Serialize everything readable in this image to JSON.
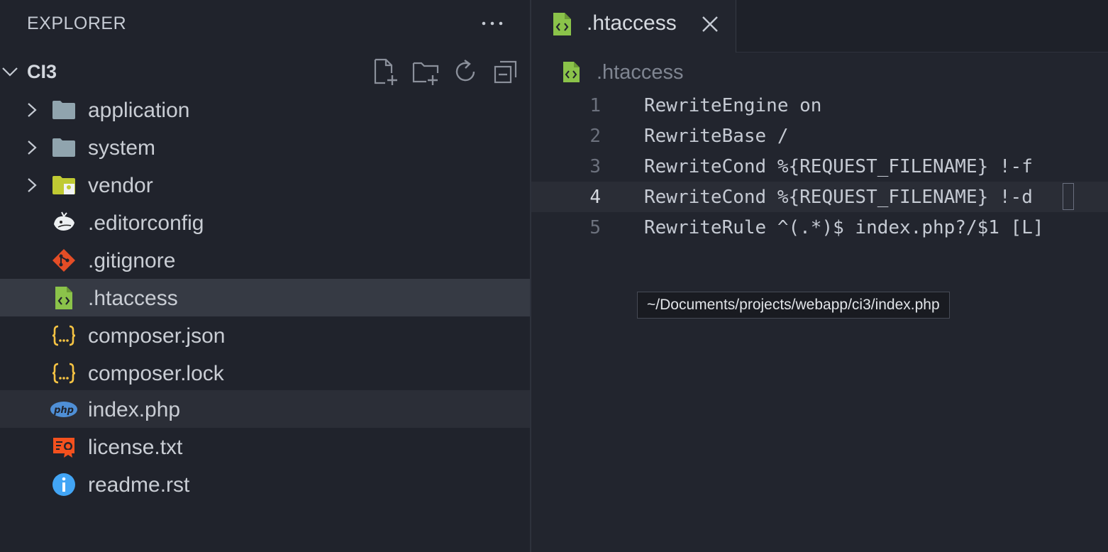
{
  "sidebar": {
    "title": "EXPLORER",
    "project": {
      "name": "CI3",
      "tools": [
        "new-file-icon",
        "new-folder-icon",
        "refresh-icon",
        "collapse-all-icon"
      ]
    },
    "items": [
      {
        "label": "application",
        "icon": "folder-icon",
        "type": "folder"
      },
      {
        "label": "system",
        "icon": "folder-icon",
        "type": "folder"
      },
      {
        "label": "vendor",
        "icon": "vendor-folder-icon",
        "type": "folder"
      },
      {
        "label": ".editorconfig",
        "icon": "editorconfig-icon",
        "type": "file"
      },
      {
        "label": ".gitignore",
        "icon": "git-icon",
        "type": "file"
      },
      {
        "label": ".htaccess",
        "icon": "htaccess-file-icon",
        "type": "file",
        "selected": true
      },
      {
        "label": "composer.json",
        "icon": "json-braces-icon",
        "type": "file"
      },
      {
        "label": "composer.lock",
        "icon": "json-braces-icon",
        "type": "file"
      },
      {
        "label": "index.php",
        "icon": "php-icon",
        "type": "file",
        "hover": true
      },
      {
        "label": "license.txt",
        "icon": "license-icon",
        "type": "file"
      },
      {
        "label": "readme.rst",
        "icon": "info-icon",
        "type": "file"
      }
    ]
  },
  "editor": {
    "tab": {
      "label": ".htaccess",
      "icon": "htaccess-file-icon"
    },
    "breadcrumb": ".htaccess",
    "lines": [
      {
        "n": "1",
        "text": "RewriteEngine on"
      },
      {
        "n": "2",
        "text": "RewriteBase /"
      },
      {
        "n": "3",
        "text": "RewriteCond %{REQUEST_FILENAME} !-f"
      },
      {
        "n": "4",
        "text": "RewriteCond %{REQUEST_FILENAME} !-d",
        "current": true
      },
      {
        "n": "5",
        "text": "RewriteRule ^(.*)$ index.php?/$1 [L]"
      }
    ],
    "tooltip": "~/Documents/projects/webapp/ci3/index.php"
  },
  "colors": {
    "sidebar_bg": "#20232c",
    "editor_bg": "#22252e",
    "selected_row": "#363a44",
    "htaccess_green": "#8bc34a",
    "folder_gray": "#90a4ae",
    "json_yellow": "#f6c343",
    "git_orange": "#e44d26",
    "php_blue": "#4f8fd6",
    "info_blue": "#42a5f5"
  }
}
